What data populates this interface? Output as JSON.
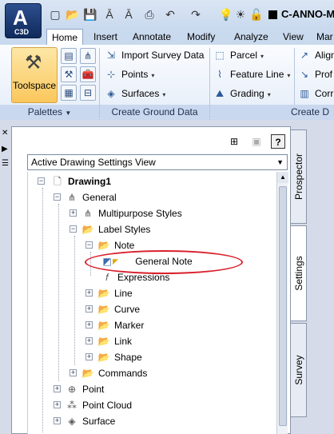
{
  "app": {
    "logo_text": "A",
    "badge": "C3D"
  },
  "title_bar": {
    "document_title": "C-ANNO-MA"
  },
  "ribbon_tabs": [
    {
      "label": "Home"
    },
    {
      "label": "Insert"
    },
    {
      "label": "Annotate"
    },
    {
      "label": "Modify"
    },
    {
      "label": "Analyze"
    },
    {
      "label": "View"
    },
    {
      "label": "Mar"
    }
  ],
  "ribbon": {
    "toolspace_label": "Toolspace",
    "palettes_label": "Palettes",
    "create_ground_label": "Create Ground Data",
    "create_design_label": "Create D",
    "ground_items": [
      {
        "label": "Import Survey Data",
        "caret": ""
      },
      {
        "label": "Points",
        "caret": "▾"
      },
      {
        "label": "Surfaces",
        "caret": "▾"
      }
    ],
    "design_items": [
      {
        "label": "Parcel",
        "caret": "▾"
      },
      {
        "label": "Feature Line",
        "caret": "▾"
      },
      {
        "label": "Grading",
        "caret": "▾"
      }
    ],
    "clipped_items": [
      "Align",
      "Prof",
      "Corr"
    ]
  },
  "palette": {
    "view_selector": "Active Drawing Settings View",
    "help_label": "?",
    "tabs": [
      {
        "label": "Prospector"
      },
      {
        "label": "Settings"
      },
      {
        "label": "Survey"
      }
    ],
    "tree": [
      {
        "label": "Drawing1"
      },
      {
        "label": "General"
      },
      {
        "label": "Multipurpose Styles"
      },
      {
        "label": "Label Styles"
      },
      {
        "label": "Note"
      },
      {
        "label": "General Note"
      },
      {
        "label": "Expressions"
      },
      {
        "label": "Line"
      },
      {
        "label": "Curve"
      },
      {
        "label": "Marker"
      },
      {
        "label": "Link"
      },
      {
        "label": "Shape"
      },
      {
        "label": "Commands"
      },
      {
        "label": "Point"
      },
      {
        "label": "Point Cloud"
      },
      {
        "label": "Surface"
      }
    ]
  },
  "colors": {
    "highlight_ellipse": "#d9202c",
    "ribbon_accent": "#fbc75c"
  }
}
